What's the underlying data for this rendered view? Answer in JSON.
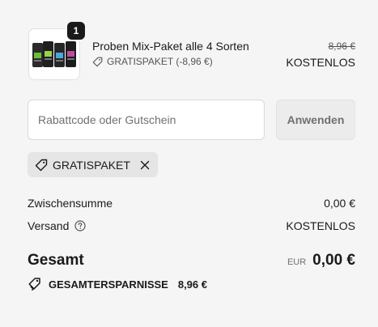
{
  "line_item": {
    "quantity": "1",
    "title": "Proben Mix-Paket alle 4 Sorten",
    "discount_label": "GRATISPAKET (-8,96 €)",
    "original_price": "8,96 €",
    "price": "KOSTENLOS"
  },
  "coupon": {
    "placeholder": "Rabattcode oder Gutschein",
    "value": "",
    "apply_label": "Anwenden"
  },
  "applied_discount": {
    "code": "GRATISPAKET"
  },
  "summary": {
    "subtotal_label": "Zwischensumme",
    "subtotal_value": "0,00 €",
    "shipping_label": "Versand",
    "shipping_value": "KOSTENLOS",
    "total_label": "Gesamt",
    "currency": "EUR",
    "total_value": "0,00 €",
    "savings_label": "GESAMTERSPARNISSE",
    "savings_value": "8,96 €"
  },
  "icons": {
    "tag": "tag-icon",
    "remove": "close-icon",
    "help": "question-circle-icon",
    "savings": "tags-icon"
  },
  "colors": {
    "background": "#f5f5f5",
    "text": "#1a1a1a",
    "muted": "#707070",
    "badge": "#1a1a1a"
  }
}
